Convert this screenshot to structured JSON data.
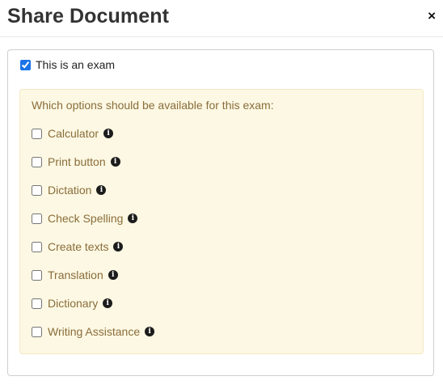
{
  "dialog": {
    "title": "Share Document",
    "close_glyph": "×"
  },
  "exam": {
    "label": "This is an exam",
    "checked": true
  },
  "options": {
    "heading": "Which options should be available for this exam:",
    "info_glyph": "i",
    "items": [
      {
        "label": "Calculator",
        "checked": false
      },
      {
        "label": "Print button",
        "checked": false
      },
      {
        "label": "Dictation",
        "checked": false
      },
      {
        "label": "Check Spelling",
        "checked": false
      },
      {
        "label": "Create texts",
        "checked": false
      },
      {
        "label": "Translation",
        "checked": false
      },
      {
        "label": "Dictionary",
        "checked": false
      },
      {
        "label": "Writing Assistance",
        "checked": false
      }
    ]
  },
  "colors": {
    "title": "#333333",
    "options_background": "#fcf8e3",
    "options_text": "#8a6d3b",
    "checkbox_accent": "#1a73e8"
  }
}
